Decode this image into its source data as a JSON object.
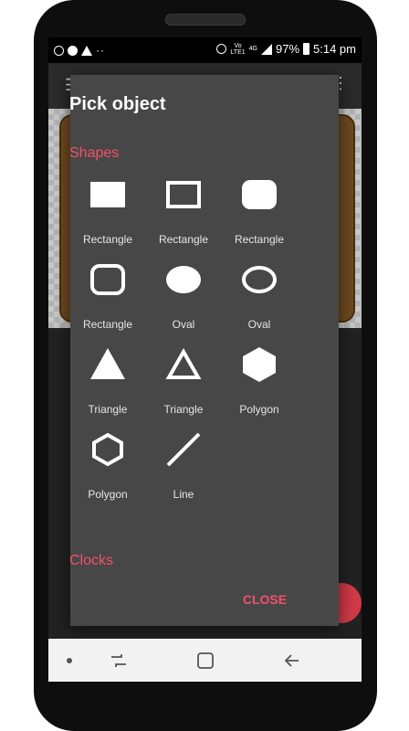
{
  "status_bar": {
    "volte": "Vo\nLTE1",
    "network": "4G",
    "battery_percent": "97%",
    "time": "5:14 pm",
    "left_more": "··"
  },
  "dialog": {
    "title": "Pick object",
    "section_shapes": "Shapes",
    "section_clocks": "Clocks",
    "close_label": "CLOSE",
    "items": [
      {
        "label": "Rectangle",
        "icon": "rectangle-filled-icon"
      },
      {
        "label": "Rectangle",
        "icon": "rectangle-outline-icon"
      },
      {
        "label": "Rectangle",
        "icon": "rounded-rectangle-filled-icon"
      },
      {
        "label": "Rectangle",
        "icon": "rounded-rectangle-outline-icon"
      },
      {
        "label": "Oval",
        "icon": "oval-filled-icon"
      },
      {
        "label": "Oval",
        "icon": "oval-outline-icon"
      },
      {
        "label": "Triangle",
        "icon": "triangle-filled-icon"
      },
      {
        "label": "Triangle",
        "icon": "triangle-outline-icon"
      },
      {
        "label": "Polygon",
        "icon": "hexagon-filled-icon"
      },
      {
        "label": "Polygon",
        "icon": "hexagon-outline-icon"
      },
      {
        "label": "Line",
        "icon": "line-icon"
      }
    ]
  },
  "colors": {
    "accent": "#f4506a",
    "dialog_bg": "#474747",
    "shape_fill": "#ffffff"
  }
}
